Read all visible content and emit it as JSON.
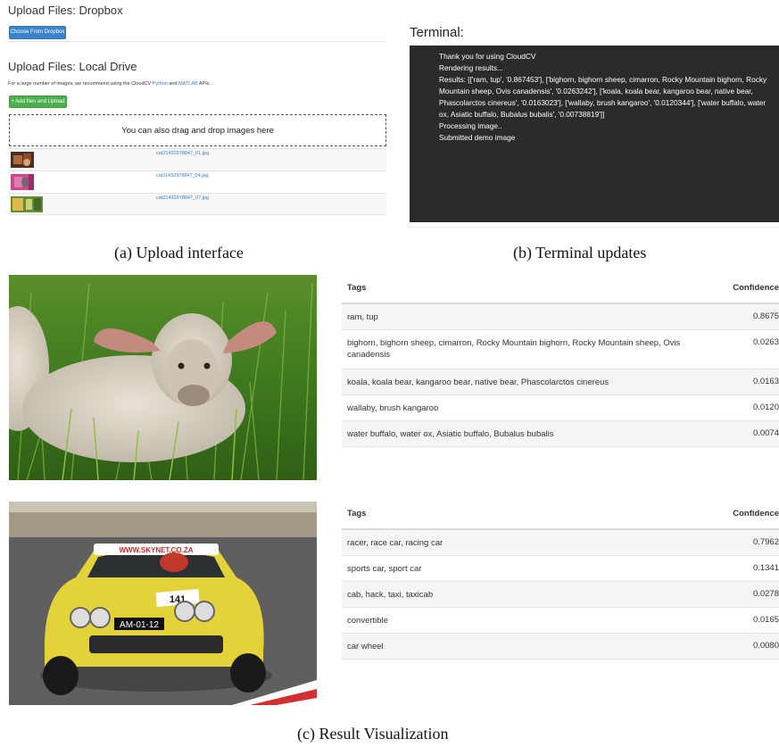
{
  "upload": {
    "dropbox_title": "Upload Files: Dropbox",
    "dropbox_button": "Choose From Dropbox",
    "local_title": "Upload Files: Local Drive",
    "recommend_prefix": "For a large number of images, we recommend using the CloudCV ",
    "recommend_python": "Python",
    "recommend_and": " and ",
    "recommend_matlab": "MATLAB",
    "recommend_suffix": " APIs.",
    "add_button": "+ Add files and Upload",
    "drop_text": "You can also drag and drop images here",
    "files": [
      {
        "name": "cat21432978847_01.jpg"
      },
      {
        "name": "cat11432978847_04.jpg"
      },
      {
        "name": "cat21432978847_07.jpg"
      }
    ]
  },
  "terminal": {
    "title": "Terminal:",
    "lines": [
      "Thank you for using CloudCV",
      "Rendering results...",
      "Results: [['ram, tup', '0.867453'], ['bighorn, bighorn sheep, cimarron, Rocky Mountain bighorn, Rocky Mountain sheep, Ovis canadensis', '0.0263242'], ['koala, koala bear, kangaroo bear, native bear, Phascolarctos cinereus', '0.0163023'], ['wallaby, brush kangaroo', '0.0120344'], ['water buffalo, water ox, Asiatic buffalo, Bubalus bubalis', '0.00738819']]",
      "Processing image..",
      "Submitted demo image"
    ]
  },
  "captions": {
    "a": "(a) Upload interface",
    "b": "(b) Terminal updates",
    "c": "(c) Result Visualization"
  },
  "results": [
    {
      "header": {
        "tags": "Tags",
        "confidence": "Confidence"
      },
      "rows": [
        {
          "tags": "ram, tup",
          "confidence": "0.8675"
        },
        {
          "tags": "bighorn, bighorn sheep, cimarron, Rocky Mountain bighorn, Rocky Mountain sheep, Ovis canadensis",
          "confidence": "0.0263"
        },
        {
          "tags": "koala, koala bear, kangaroo bear, native bear, Phascolarctos cinereus",
          "confidence": "0.0163"
        },
        {
          "tags": "wallaby, brush kangaroo",
          "confidence": "0.0120"
        },
        {
          "tags": "water buffalo, water ox, Asiatic buffalo, Bubalus bubalis",
          "confidence": "0.0074"
        }
      ]
    },
    {
      "header": {
        "tags": "Tags",
        "confidence": "Confidence"
      },
      "rows": [
        {
          "tags": "racer, race car, racing car",
          "confidence": "0.7962"
        },
        {
          "tags": "sports car, sport car",
          "confidence": "0.1341"
        },
        {
          "tags": "cab, hack, taxi, taxicab",
          "confidence": "0.0278"
        },
        {
          "tags": "convertible",
          "confidence": "0.0165"
        },
        {
          "tags": "car wheel",
          "confidence": "0.0080"
        }
      ]
    }
  ],
  "photos": {
    "car_banner": "WWW.SKYNET.CO.ZA",
    "car_number": "141",
    "car_plate": "AM-01-12"
  },
  "colors": {
    "dropbox_button": "#3a84c9",
    "add_button": "#4cae4c",
    "link": "#3a7bc8",
    "terminal_bg": "#2b2b2b"
  }
}
